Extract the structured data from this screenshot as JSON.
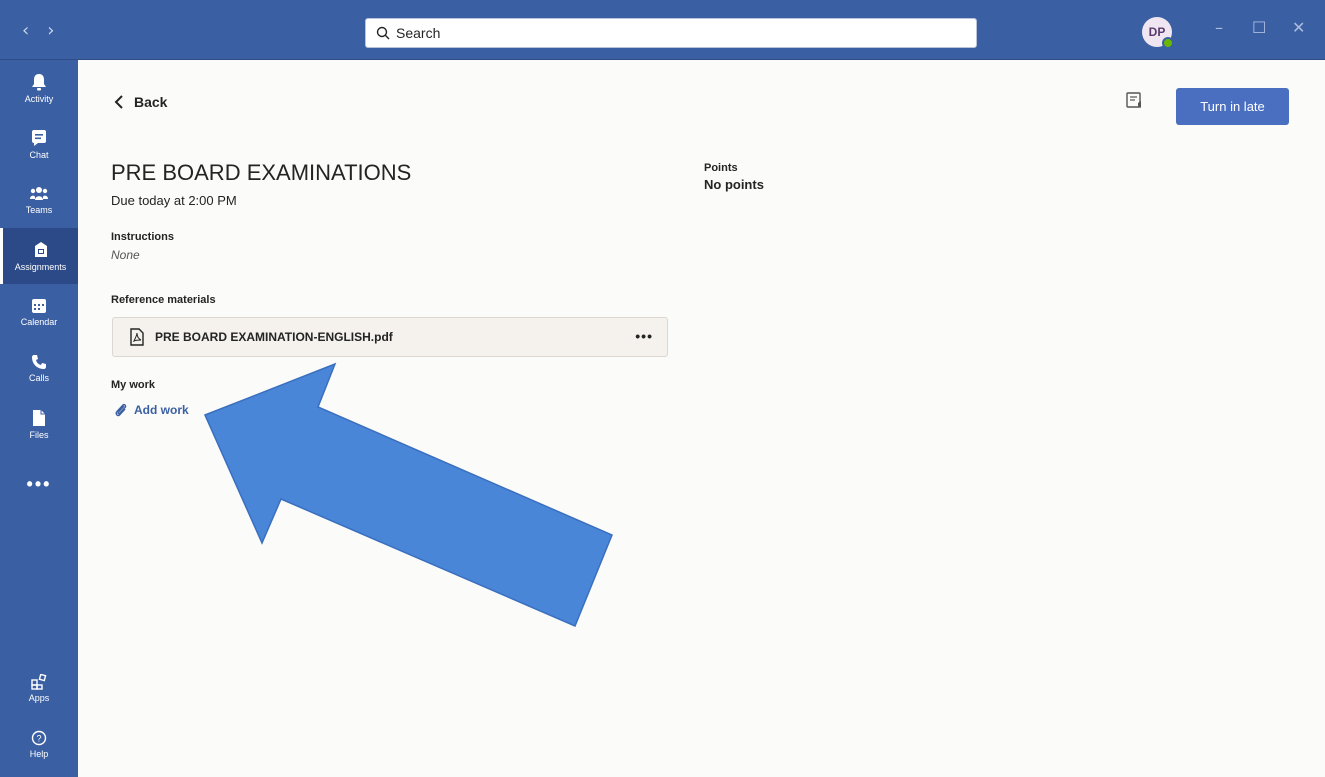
{
  "search": {
    "placeholder": "Search"
  },
  "user": {
    "initials": "DP"
  },
  "rail": {
    "items": [
      {
        "label": "Activity",
        "icon": "bell-icon"
      },
      {
        "label": "Chat",
        "icon": "chat-icon"
      },
      {
        "label": "Teams",
        "icon": "teams-icon"
      },
      {
        "label": "Assignments",
        "icon": "assignments-icon"
      },
      {
        "label": "Calendar",
        "icon": "calendar-icon"
      },
      {
        "label": "Calls",
        "icon": "phone-icon"
      },
      {
        "label": "Files",
        "icon": "file-icon"
      }
    ],
    "more": "•••",
    "bottom": [
      {
        "label": "Apps",
        "icon": "apps-icon"
      },
      {
        "label": "Help",
        "icon": "help-icon"
      }
    ]
  },
  "main": {
    "back_label": "Back",
    "title": "PRE BOARD EXAMINATIONS",
    "due": "Due today at 2:00 PM",
    "instructions_label": "Instructions",
    "instructions_value": "None",
    "points_label": "Points",
    "points_value": "No points",
    "reference_label": "Reference materials",
    "reference_file": "PRE BOARD EXAMINATION-ENGLISH.pdf",
    "my_work_label": "My work",
    "add_work_label": "Add work",
    "turn_in_label": "Turn in late"
  },
  "colors": {
    "accent": "#3b5fa3",
    "button": "#4a6fc1",
    "overlay_arrow": "#4a86d8"
  }
}
